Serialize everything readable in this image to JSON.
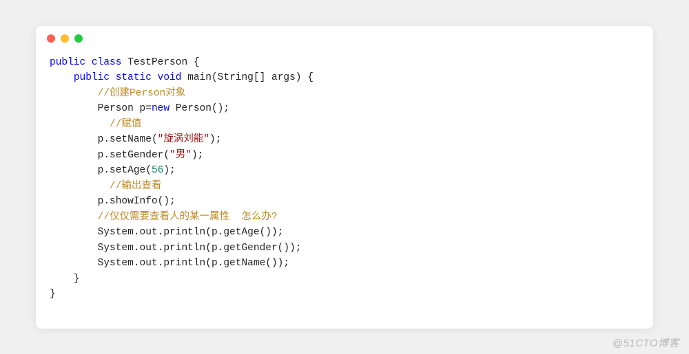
{
  "watermark": "@51CTO博客",
  "code": {
    "l1": {
      "kw1": "public",
      "kw2": "class",
      "name": "TestPerson",
      "brace": " {"
    },
    "l2": {
      "indent": "    ",
      "kw1": "public",
      "kw2": "static",
      "kw3": "void",
      "fn": " main(String[] args) {"
    },
    "l3": {
      "indent": "        ",
      "cmt": "//创建Person对象"
    },
    "l4": {
      "indent": "        ",
      "a": "Person p=",
      "kw": "new",
      "b": " Person();"
    },
    "l5": {
      "indent": "          ",
      "cmt": "//赋值"
    },
    "l6": {
      "indent": "        ",
      "a": "p.setName(",
      "str": "\"旋涡刘能\"",
      "b": ");"
    },
    "l7": {
      "indent": "        ",
      "a": "p.setGender(",
      "str": "\"男\"",
      "b": ");"
    },
    "l8": {
      "indent": "        ",
      "a": "p.setAge(",
      "num": "56",
      "b": ");"
    },
    "l9": {
      "indent": "          ",
      "cmt": "//输出查看"
    },
    "l10": {
      "indent": "        ",
      "a": "p.showInfo();"
    },
    "l11": {
      "indent": "        ",
      "cmt": "//仅仅需要查看人的某一属性  怎么办?"
    },
    "l12": {
      "indent": "        ",
      "a": "System.out.println(p.getAge());"
    },
    "l13": {
      "indent": "        ",
      "a": "System.out.println(p.getGender());"
    },
    "l14": {
      "indent": "        ",
      "a": "System.out.println(p.getName());"
    },
    "l15": {
      "indent": "    ",
      "a": "}"
    },
    "l16": {
      "a": "}"
    }
  }
}
